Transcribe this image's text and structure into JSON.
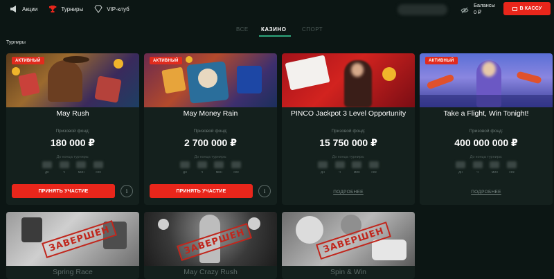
{
  "header": {
    "nav": [
      {
        "label": "Акции",
        "icon": "megaphone-icon"
      },
      {
        "label": "Турниры",
        "icon": "trophy-icon"
      },
      {
        "label": "VIP-клуб",
        "icon": "diamond-icon"
      }
    ],
    "balance_label": "Балансы",
    "balance_value": "0 ₽",
    "cashier_label": "В КАССУ"
  },
  "tabs": [
    {
      "label": "ВСЕ",
      "active": false
    },
    {
      "label": "КАЗИНО",
      "active": true
    },
    {
      "label": "СПОРТ",
      "active": false
    }
  ],
  "section_title": "Турниры",
  "common": {
    "active_badge": "АКТИВНЫЙ",
    "prize_label": "Призовой фонд:",
    "countdown_label": "До конца турнира:",
    "countdown_units": [
      "дн",
      "ч",
      "мин",
      "сек"
    ],
    "join_label": "ПРИНЯТЬ УЧАСТИЕ",
    "more_label": "ПОДРОБНЕЕ",
    "finished_stamp": "ЗАВЕРШЕН",
    "info_icon": "info-icon"
  },
  "cards": [
    {
      "title": "May Rush",
      "prize": "180 000 ₽",
      "status": "active",
      "action": "join"
    },
    {
      "title": "May Money Rain",
      "prize": "2 700 000 ₽",
      "status": "active",
      "action": "join"
    },
    {
      "title": "PINCO Jackpot 3 Level Opportunity",
      "prize": "15 750 000 ₽",
      "status": "other",
      "action": "more"
    },
    {
      "title": "Take a Flight, Win Tonight!",
      "prize": "400 000 000 ₽",
      "status": "active",
      "action": "more"
    },
    {
      "title": "Spring Race",
      "status": "finished"
    },
    {
      "title": "May Crazy Rush",
      "status": "finished"
    },
    {
      "title": "Spin & Win",
      "status": "finished"
    }
  ],
  "colors": {
    "background": "#0c1614",
    "card": "#14201d",
    "accent_red": "#e9261b",
    "tab_underline": "#2fa77e"
  }
}
